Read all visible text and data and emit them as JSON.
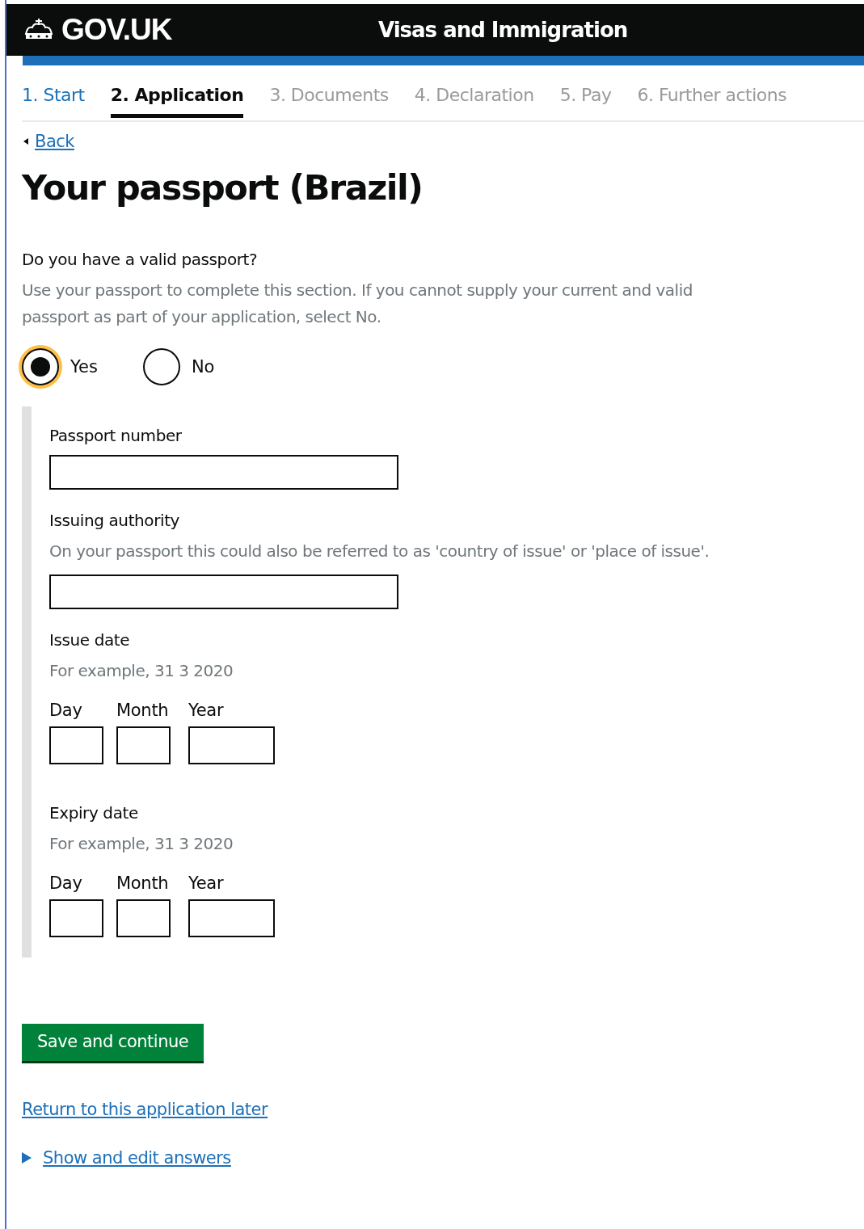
{
  "header": {
    "logo": "GOV.UK",
    "service": "Visas and Immigration"
  },
  "steps": [
    {
      "label": "1. Start",
      "selected": false,
      "completed": true
    },
    {
      "label": "2. Application",
      "selected": true,
      "completed": false
    },
    {
      "label": "3. Documents",
      "selected": false,
      "completed": false
    },
    {
      "label": "4. Declaration",
      "selected": false,
      "completed": false
    },
    {
      "label": "5. Pay",
      "selected": false,
      "completed": false
    },
    {
      "label": "6. Further actions",
      "selected": false,
      "completed": false
    }
  ],
  "back_link": "Back",
  "title": "Your passport (Brazil)",
  "question": {
    "label": "Do you have a valid passport?",
    "hint": "Use your passport to complete this section. If you cannot supply your current and valid passport as part of your application, select No.",
    "options": [
      {
        "label": "Yes",
        "selected": true
      },
      {
        "label": "No",
        "selected": false
      }
    ]
  },
  "fields": [
    {
      "kind": "text",
      "label": "Passport number"
    },
    {
      "kind": "text",
      "label": "Issuing authority",
      "hint": "On your passport this could also be referred to as 'country of issue' or 'place of issue'."
    },
    {
      "kind": "date",
      "label": "Issue date",
      "hint": "For example, 31 3 2020",
      "parts": [
        "Day",
        "Month",
        "Year"
      ]
    },
    {
      "kind": "date",
      "label": "Expiry date",
      "hint": "For example, 31 3 2020",
      "parts": [
        "Day",
        "Month",
        "Year"
      ]
    }
  ],
  "button": "Save and continue",
  "return_link": "Return to this application later",
  "details": {
    "label": "Show and edit answers",
    "expanded": false
  }
}
